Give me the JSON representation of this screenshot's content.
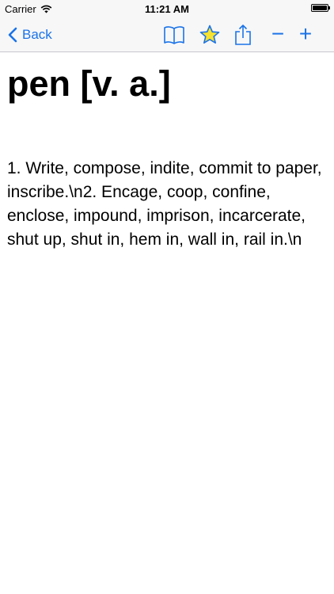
{
  "status_bar": {
    "carrier": "Carrier",
    "time": "11:21 AM"
  },
  "nav_bar": {
    "back_label": "Back",
    "zoom_out_label": "−",
    "zoom_in_label": "+"
  },
  "entry": {
    "headword": "pen [v. a.]",
    "definition": "1. Write, compose, indite, commit to paper, inscribe.\\n2. Encage, coop, confine, enclose, impound, imprison, incarcerate, shut up, shut in, hem in, wall in, rail in.\\n"
  },
  "colors": {
    "accent": "#1a73e8",
    "star_fill": "#f5e130",
    "bar_background": "#f7f7f8"
  },
  "icons": [
    "wifi-icon",
    "battery-icon",
    "chevron-left-icon",
    "book-icon",
    "star-icon",
    "share-icon"
  ]
}
